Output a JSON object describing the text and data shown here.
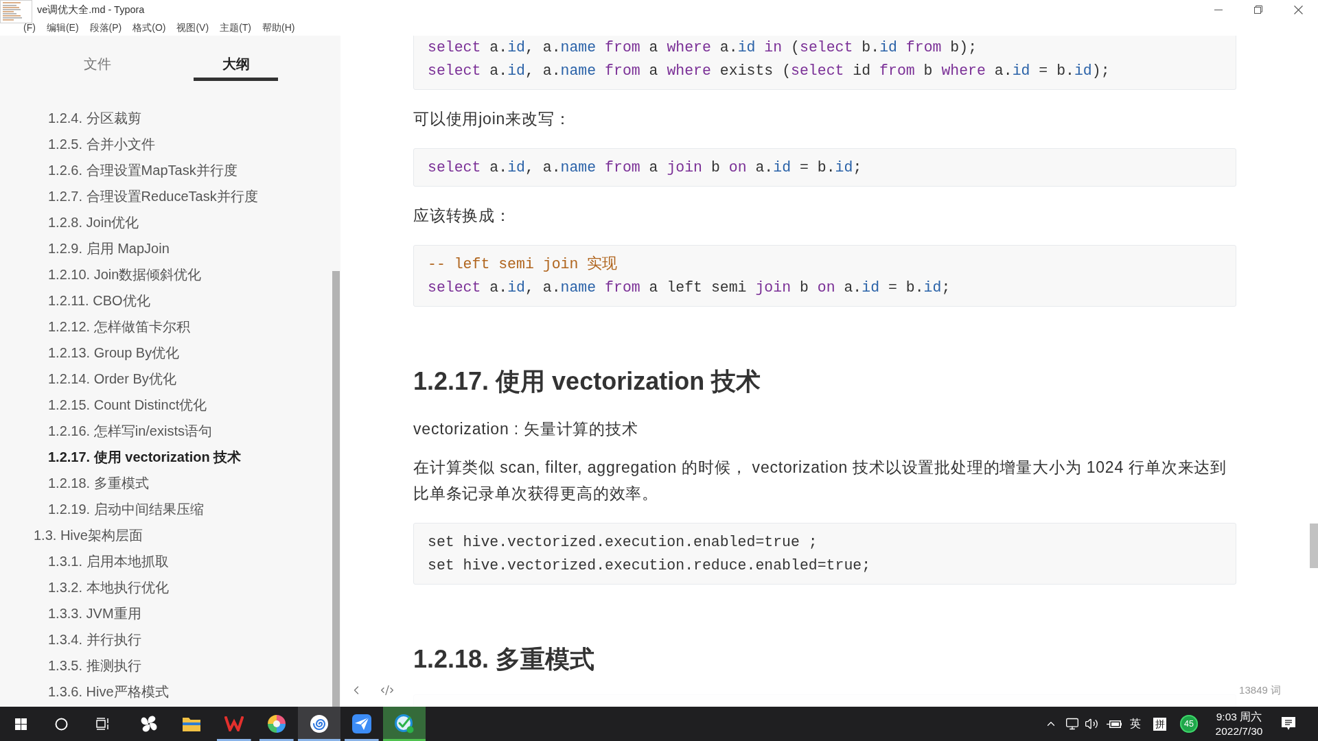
{
  "window": {
    "title": "ve调优大全.md - Typora"
  },
  "menu": [
    "(F)",
    "编辑(E)",
    "段落(P)",
    "格式(O)",
    "视图(V)",
    "主题(T)",
    "帮助(H)"
  ],
  "sidebar": {
    "tabs": [
      {
        "label": "文件",
        "selected": false
      },
      {
        "label": "大纲",
        "selected": true
      }
    ],
    "outline": [
      {
        "children": [
          {
            "label": "1.2.4. 分区裁剪",
            "selected": false
          },
          {
            "label": "1.2.5. 合并小文件",
            "selected": false
          },
          {
            "label": "1.2.6. 合理设置MapTask并行度",
            "selected": false
          },
          {
            "label": "1.2.7. 合理设置ReduceTask并行度",
            "selected": false
          },
          {
            "label": "1.2.8. Join优化",
            "selected": false
          },
          {
            "label": "1.2.9. 启用 MapJoin",
            "selected": false
          },
          {
            "label": "1.2.10. Join数据倾斜优化",
            "selected": false
          },
          {
            "label": "1.2.11. CBO优化",
            "selected": false
          },
          {
            "label": "1.2.12. 怎样做笛卡尔积",
            "selected": false
          },
          {
            "label": "1.2.13. Group By优化",
            "selected": false
          },
          {
            "label": "1.2.14. Order By优化",
            "selected": false
          },
          {
            "label": "1.2.15. Count Distinct优化",
            "selected": false
          },
          {
            "label": "1.2.16. 怎样写in/exists语句",
            "selected": false
          },
          {
            "label": "1.2.17. 使用 vectorization 技术",
            "selected": true
          },
          {
            "label": "1.2.18. 多重模式",
            "selected": false
          },
          {
            "label": "1.2.19. 启动中间结果压缩",
            "selected": false
          }
        ]
      },
      {
        "label": "1.3. Hive架构层面",
        "selected": false,
        "children": [
          {
            "label": "1.3.1. 启用本地抓取",
            "selected": false
          },
          {
            "label": "1.3.2. 本地执行优化",
            "selected": false
          },
          {
            "label": "1.3.3. JVM重用",
            "selected": false
          },
          {
            "label": "1.3.4. 并行执行",
            "selected": false
          },
          {
            "label": "1.3.5. 推测执行",
            "selected": false
          },
          {
            "label": "1.3.6. Hive严格模式",
            "selected": false
          }
        ]
      }
    ]
  },
  "document": {
    "blocks": [
      {
        "kind": "code",
        "lines": [
          [
            {
              "text": "select",
              "kind": "keyword"
            },
            {
              "text": " a.",
              "kind": "plain"
            },
            {
              "text": "id",
              "kind": "property"
            },
            {
              "text": ", a.",
              "kind": "plain"
            },
            {
              "text": "name",
              "kind": "property"
            },
            {
              "text": " from",
              "kind": "keyword"
            },
            {
              "text": " a ",
              "kind": "plain"
            },
            {
              "text": "where",
              "kind": "keyword"
            },
            {
              "text": " a.",
              "kind": "plain"
            },
            {
              "text": "id",
              "kind": "property"
            },
            {
              "text": " in",
              "kind": "keyword"
            },
            {
              "text": " (",
              "kind": "plain"
            },
            {
              "text": "select",
              "kind": "keyword"
            },
            {
              "text": " b.",
              "kind": "plain"
            },
            {
              "text": "id",
              "kind": "property"
            },
            {
              "text": " from",
              "kind": "keyword"
            },
            {
              "text": " b);",
              "kind": "plain"
            }
          ],
          [
            {
              "text": "select",
              "kind": "keyword"
            },
            {
              "text": " a.",
              "kind": "plain"
            },
            {
              "text": "id",
              "kind": "property"
            },
            {
              "text": ", a.",
              "kind": "plain"
            },
            {
              "text": "name",
              "kind": "property"
            },
            {
              "text": " from",
              "kind": "keyword"
            },
            {
              "text": " a ",
              "kind": "plain"
            },
            {
              "text": "where",
              "kind": "keyword"
            },
            {
              "text": " exists (",
              "kind": "plain"
            },
            {
              "text": "select",
              "kind": "keyword"
            },
            {
              "text": " id ",
              "kind": "plain"
            },
            {
              "text": "from",
              "kind": "keyword"
            },
            {
              "text": " b ",
              "kind": "plain"
            },
            {
              "text": "where",
              "kind": "keyword"
            },
            {
              "text": " a.",
              "kind": "plain"
            },
            {
              "text": "id",
              "kind": "property"
            },
            {
              "text": " = b.",
              "kind": "plain"
            },
            {
              "text": "id",
              "kind": "property"
            },
            {
              "text": ");",
              "kind": "plain"
            }
          ]
        ]
      },
      {
        "kind": "paragraph",
        "text": "可以使用join来改写："
      },
      {
        "kind": "code",
        "lines": [
          [
            {
              "text": "select",
              "kind": "keyword"
            },
            {
              "text": " a.",
              "kind": "plain"
            },
            {
              "text": "id",
              "kind": "property"
            },
            {
              "text": ", a.",
              "kind": "plain"
            },
            {
              "text": "name",
              "kind": "property"
            },
            {
              "text": " from",
              "kind": "keyword"
            },
            {
              "text": " a ",
              "kind": "plain"
            },
            {
              "text": "join",
              "kind": "keyword"
            },
            {
              "text": " b ",
              "kind": "plain"
            },
            {
              "text": "on",
              "kind": "keyword"
            },
            {
              "text": " a.",
              "kind": "plain"
            },
            {
              "text": "id",
              "kind": "property"
            },
            {
              "text": " = b.",
              "kind": "plain"
            },
            {
              "text": "id",
              "kind": "property"
            },
            {
              "text": ";",
              "kind": "plain"
            }
          ]
        ]
      },
      {
        "kind": "paragraph",
        "text": "应该转换成："
      },
      {
        "kind": "code",
        "lines": [
          [
            {
              "text": "-- left semi join 实现",
              "kind": "comment"
            }
          ],
          [
            {
              "text": "select",
              "kind": "keyword"
            },
            {
              "text": " a.",
              "kind": "plain"
            },
            {
              "text": "id",
              "kind": "property"
            },
            {
              "text": ", a.",
              "kind": "plain"
            },
            {
              "text": "name",
              "kind": "property"
            },
            {
              "text": " from",
              "kind": "keyword"
            },
            {
              "text": " a left semi ",
              "kind": "plain"
            },
            {
              "text": "join",
              "kind": "keyword"
            },
            {
              "text": " b ",
              "kind": "plain"
            },
            {
              "text": "on",
              "kind": "keyword"
            },
            {
              "text": " a.",
              "kind": "plain"
            },
            {
              "text": "id",
              "kind": "property"
            },
            {
              "text": " = b.",
              "kind": "plain"
            },
            {
              "text": "id",
              "kind": "property"
            },
            {
              "text": ";",
              "kind": "plain"
            }
          ]
        ]
      },
      {
        "kind": "heading",
        "text": "1.2.17. 使用 vectorization 技术"
      },
      {
        "kind": "paragraph",
        "text": "vectorization : 矢量计算的技术"
      },
      {
        "kind": "paragraph",
        "text": "在计算类似 scan, filter, aggregation 的时候， vectorization 技术以设置批处理的增量大小为 1024 行单次来达到比单条记录单次获得更高的效率。"
      },
      {
        "kind": "code",
        "lines": [
          [
            {
              "text": "set hive.vectorized.execution.enabled=true ;",
              "kind": "plain"
            }
          ],
          [
            {
              "text": "set hive.vectorized.execution.reduce.enabled=true;",
              "kind": "plain"
            }
          ]
        ]
      },
      {
        "kind": "heading",
        "text": "1.2.18. 多重模式"
      },
      {
        "kind": "code"
      }
    ]
  },
  "footer": {
    "word_count": "13849 词"
  },
  "taskbar": {
    "apps": [
      {
        "kind": "pinwheel",
        "running": false,
        "selected": false,
        "highlighted": false
      },
      {
        "kind": "folder",
        "running": false,
        "selected": false,
        "highlighted": false
      },
      {
        "kind": "zigzag",
        "running": true,
        "selected": false,
        "highlighted": false
      },
      {
        "kind": "colorwheel",
        "running": true,
        "selected": false,
        "highlighted": false
      },
      {
        "kind": "spiral",
        "running": true,
        "selected": true,
        "highlighted": false
      },
      {
        "kind": "plane",
        "running": true,
        "selected": false,
        "highlighted": false
      },
      {
        "kind": "checkmark",
        "running": true,
        "selected": false,
        "highlighted": true
      }
    ],
    "language": "英",
    "ime_mode": "拼",
    "badge": "45",
    "time": "9:03 周六",
    "date": "2022/7/30"
  }
}
